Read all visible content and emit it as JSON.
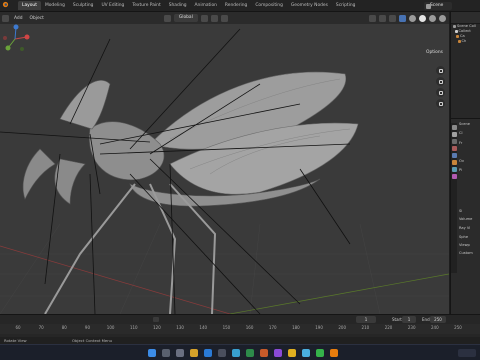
{
  "workspaces": [
    "Layout",
    "Modeling",
    "Sculpting",
    "UV Editing",
    "Texture Paint",
    "Shading",
    "Animation",
    "Rendering",
    "Compositing",
    "Geometry Nodes",
    "Scripting"
  ],
  "active_workspace": "Layout",
  "scene_name": "Scene",
  "viewport_header": {
    "mode_menu": "Add",
    "object_menu": "Object",
    "orientation": "Global",
    "options_label": "Options"
  },
  "outliner": {
    "rows": [
      "Scene Coll",
      "Collect",
      "Ca",
      "Ch"
    ]
  },
  "properties": {
    "scene_label": "Scene",
    "rows": [
      "Cl",
      "Fr",
      "Ov",
      "Pi",
      "Si",
      "Volume",
      "Ray Vi",
      "Sphe",
      "Viewp",
      "Custom"
    ]
  },
  "timeline": {
    "ticks": [
      "60",
      "70",
      "80",
      "90",
      "100",
      "110",
      "120",
      "130",
      "140",
      "150",
      "160",
      "170",
      "180",
      "190",
      "200",
      "210",
      "220",
      "230",
      "240",
      "250"
    ],
    "current_frame": "1",
    "start_label": "Start",
    "start_value": "1",
    "end_label": "End",
    "end_value": "250"
  },
  "statusbar": {
    "left": "Rotate View",
    "center": "Object Context Menu"
  },
  "colors": {
    "accent": "#4772b3",
    "viewport_bg": "#3a3a3a",
    "panel_bg": "#2b2b2b"
  },
  "icons": [
    "blender-logo-icon",
    "camera-icon",
    "hand-icon",
    "zoom-icon",
    "grid-icon",
    "sphere-shading-icon"
  ]
}
